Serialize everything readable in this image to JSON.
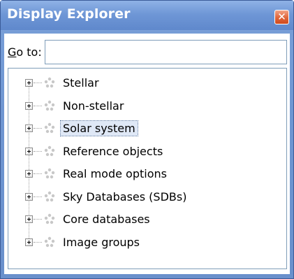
{
  "window": {
    "title": "Display Explorer",
    "close_glyph": "✕"
  },
  "goto": {
    "label_accel": "G",
    "label_rest": "o to:",
    "value": "",
    "placeholder": ""
  },
  "tree": {
    "selected_index": 2,
    "items": [
      {
        "label": "Stellar",
        "expander": "+",
        "icon": "dots-icon"
      },
      {
        "label": "Non-stellar",
        "expander": "+",
        "icon": "dots-icon"
      },
      {
        "label": "Solar system",
        "expander": "+",
        "icon": "dots-icon"
      },
      {
        "label": "Reference objects",
        "expander": "+",
        "icon": "dots-icon"
      },
      {
        "label": "Real mode options",
        "expander": "+",
        "icon": "dots-icon"
      },
      {
        "label": "Sky Databases (SDBs)",
        "expander": "+",
        "icon": "dots-icon"
      },
      {
        "label": "Core databases",
        "expander": "+",
        "icon": "dots-icon"
      },
      {
        "label": "Image groups",
        "expander": "+",
        "icon": "dots-icon"
      }
    ]
  },
  "colors": {
    "titlebar": "#6f97d6",
    "close_button": "#e0653a",
    "selection": "#dfe8f6",
    "border": "#7f9db9"
  }
}
